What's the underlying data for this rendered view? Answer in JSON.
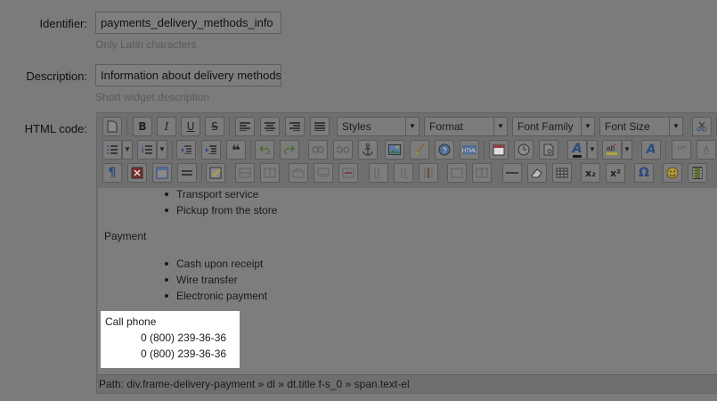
{
  "form": {
    "identifier": {
      "label": "Identifier:",
      "value": "payments_delivery_methods_info",
      "hint": "Only Latin characters"
    },
    "description": {
      "label": "Description:",
      "value": "Information about delivery methods",
      "hint": "Short widget description"
    },
    "html_code": {
      "label": "HTML code:"
    }
  },
  "toolbar": {
    "dropdowns": {
      "styles": "Styles",
      "format": "Format",
      "font_family": "Font Family",
      "font_size": "Font Size"
    },
    "glyphs": {
      "bold": "B",
      "italic": "I",
      "underline": "U",
      "strike": "S",
      "blockquote": "❝",
      "pilcrow": "¶",
      "omega": "Ω",
      "subscript": "x₂",
      "superscript": "x²",
      "text_color": "A",
      "clear_format": "A"
    }
  },
  "editor": {
    "list_top": [
      "Transport service",
      "Pickup from the store"
    ],
    "payment_heading": "Payment",
    "payment_items": [
      "Cash upon receipt",
      "Wire transfer",
      "Electronic payment"
    ],
    "call_label": "Call phone",
    "phones": [
      "0 (800) 239-36-36",
      "0 (800) 239-36-36"
    ],
    "path": "Path: div.frame-delivery-payment » dl » dt.title f-s_0 » span.text-el"
  }
}
